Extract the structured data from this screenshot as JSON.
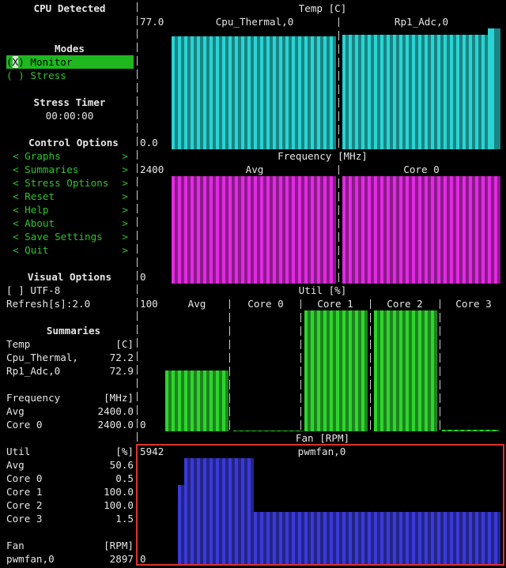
{
  "sidebar": {
    "cpu_detected": "CPU Detected",
    "modes_title": "Modes",
    "mode_monitor": {
      "check": "X",
      "label": "Monitor"
    },
    "mode_stress": {
      "check": " ",
      "label": "Stress"
    },
    "stress_timer_title": "Stress Timer",
    "stress_timer_value": "00:00:00",
    "control_title": "Control Options",
    "control_items": [
      "Graphs",
      "Summaries",
      "Stress Options",
      "Reset",
      "Help",
      "About",
      "Save Settings",
      "Quit"
    ],
    "visual_title": "Visual Options",
    "utf8": {
      "check": " ",
      "label": "UTF-8"
    },
    "refresh_label": "Refresh[s]:",
    "refresh_value": "2.0",
    "summaries_title": "Summaries",
    "summary_rows": [
      {
        "label": "Temp",
        "value": "[C]"
      },
      {
        "label": "Cpu_Thermal,",
        "value": "72.2"
      },
      {
        "label": "Rp1_Adc,0",
        "value": "72.9"
      },
      {
        "label": "",
        "value": ""
      },
      {
        "label": "Frequency",
        "value": "[MHz]"
      },
      {
        "label": "Avg",
        "value": "2400.0"
      },
      {
        "label": "Core 0",
        "value": "2400.0"
      },
      {
        "label": "",
        "value": ""
      },
      {
        "label": "Util",
        "value": "[%]"
      },
      {
        "label": "Avg",
        "value": "50.6"
      },
      {
        "label": "Core 0",
        "value": "0.5"
      },
      {
        "label": "Core 1",
        "value": "100.0"
      },
      {
        "label": "Core 2",
        "value": "100.0"
      },
      {
        "label": "Core 3",
        "value": "1.5"
      },
      {
        "label": "",
        "value": ""
      },
      {
        "label": "Fan",
        "value": "[RPM]"
      },
      {
        "label": "pwmfan,0",
        "value": "2897"
      }
    ]
  },
  "graphs": {
    "temp": {
      "title": "Temp [C]",
      "ymax": "77.0",
      "ymin": "0.0",
      "series": [
        "Cpu_Thermal,0",
        "Rp1_Adc,0"
      ],
      "color": "#2ad3d3",
      "max_value": 77.0,
      "values": [
        [
          72.2
        ],
        [
          72.9
        ]
      ]
    },
    "freq": {
      "title": "Frequency [MHz]",
      "ymax": "2400",
      "ymin": "0",
      "series": [
        "Avg",
        "Core 0"
      ],
      "color": "#e02ae0",
      "max_value": 2400,
      "values": [
        [
          2400.0
        ],
        [
          2400.0
        ]
      ]
    },
    "util": {
      "title": "Util [%]",
      "ymax": "100",
      "ymin": "0",
      "series": [
        "Avg",
        "Core 0",
        "Core 1",
        "Core 2",
        "Core 3"
      ],
      "color": "#2fd42f",
      "max_value": 100,
      "values": [
        [
          50.6
        ],
        [
          0.5
        ],
        [
          100.0
        ],
        [
          100.0
        ],
        [
          1.5
        ]
      ]
    },
    "fan": {
      "title": "Fan [RPM]",
      "ymax": "5942",
      "ymin": "0",
      "series": [
        "pwmfan,0"
      ],
      "color": "#3a3ad8",
      "max_value": 5942,
      "values": [
        [
          4400,
          5500,
          5500,
          5500,
          5500,
          5500,
          5500,
          5500,
          5500,
          5500,
          5500,
          5500,
          2897,
          2897,
          2897,
          2897,
          2897,
          2897,
          2897,
          2897,
          2897,
          2897,
          2897,
          2897,
          2897,
          2897,
          2897,
          2897,
          2897,
          2897,
          2897,
          2897,
          2897,
          2897,
          2897,
          2897,
          2897,
          2897,
          2897,
          2897,
          2897,
          2897,
          2897,
          2897,
          2897,
          2897,
          2897,
          2897,
          2897,
          2897,
          2897,
          2897,
          2897,
          2897,
          2897,
          2897,
          2897,
          2897,
          2897,
          2897,
          2897,
          2897,
          2897,
          2897
        ]
      ]
    }
  }
}
